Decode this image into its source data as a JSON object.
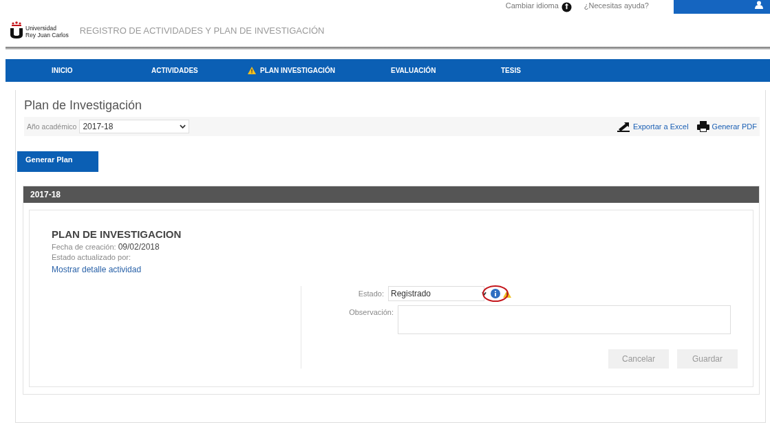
{
  "header": {
    "logo_line1": "Universidad",
    "logo_line2": "Rey Juan Carlos",
    "title": "REGISTRO DE ACTIVIDADES Y PLAN DE INVESTIGACIÓN",
    "language_link": "Cambiar idioma",
    "help_link": "¿Necesitas ayuda?"
  },
  "nav": [
    {
      "label": "INICIO",
      "warning": false
    },
    {
      "label": "ACTIVIDADES",
      "warning": false
    },
    {
      "label": "PLAN INVESTIGACIÓN",
      "warning": true
    },
    {
      "label": "EVALUACIÓN",
      "warning": false
    },
    {
      "label": "TESIS",
      "warning": false
    }
  ],
  "page_title": "Plan de Investigación",
  "filter": {
    "label": "Año académico",
    "value": "2017-18"
  },
  "actions": [
    "Exportar a Excel",
    "Generar PDF"
  ],
  "generate_button": "Generar Plan",
  "section": {
    "title": "2017-18",
    "plan": {
      "heading": "PLAN DE INVESTIGACION",
      "created_label": "Fecha de creación:",
      "created_value": "09/02/2018",
      "updated_label": "Estado actualizado por:",
      "detail_link": "Mostrar detalle actividad"
    },
    "form": {
      "status_label": "Estado:",
      "status_value": "Registrado",
      "info_highlighted": true,
      "warning": true,
      "observation_label": "Observación:",
      "buttons": [
        "Cancelar",
        "Guardar"
      ]
    }
  }
}
